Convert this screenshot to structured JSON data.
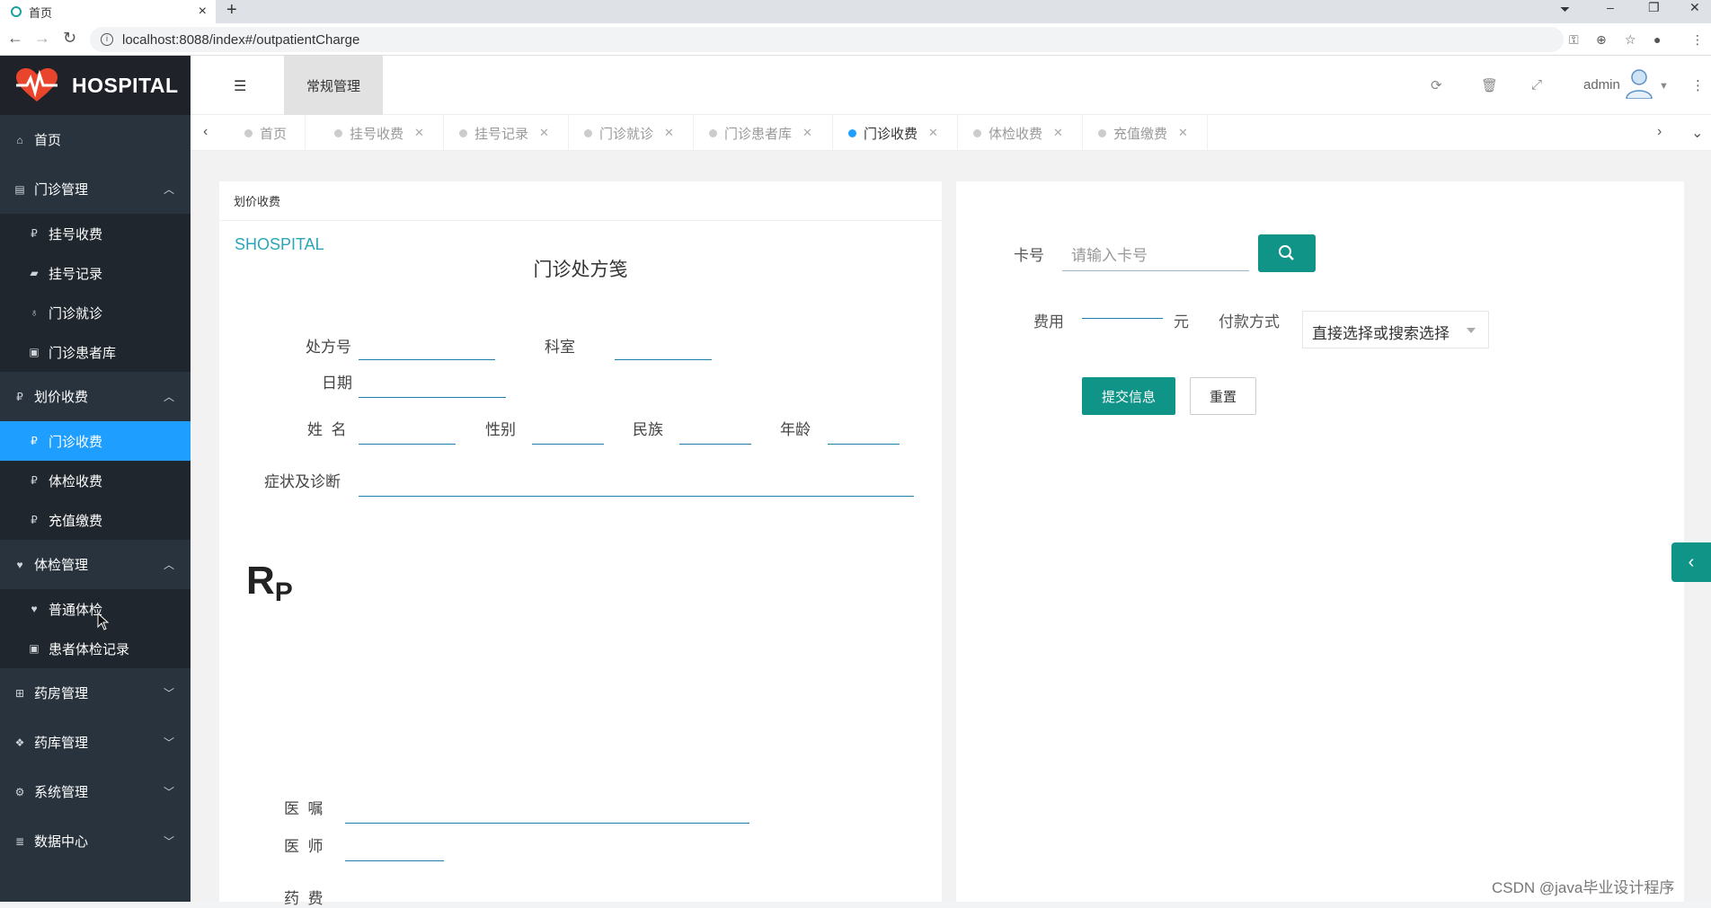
{
  "browser": {
    "tab_title": "首页",
    "tab_close": "×",
    "new_tab": "+",
    "url": "localhost:8088/index#/outpatientCharge",
    "win_min": "–",
    "win_restore": "❐",
    "win_close": "✕"
  },
  "sidebar": {
    "brand": "HOSPITAL",
    "items": [
      {
        "label": "首页",
        "icon": "home-icon"
      },
      {
        "label": "门诊管理",
        "icon": "clipboard-icon",
        "expanded": true,
        "children": [
          "挂号收费",
          "挂号记录",
          "门诊就诊",
          "门诊患者库"
        ]
      },
      {
        "label": "划价收费",
        "icon": "money-icon",
        "expanded": true,
        "children": [
          "门诊收费",
          "体检收费",
          "充值缴费"
        ],
        "active_child": "门诊收费"
      },
      {
        "label": "体检管理",
        "icon": "heartbeat-icon",
        "expanded": true,
        "children": [
          "普通体检",
          "患者体检记录"
        ]
      },
      {
        "label": "药房管理",
        "icon": "plus-square-icon"
      },
      {
        "label": "药库管理",
        "icon": "cubes-icon"
      },
      {
        "label": "系统管理",
        "icon": "gear-icon"
      },
      {
        "label": "数据中心",
        "icon": "database-icon"
      }
    ]
  },
  "header": {
    "top_nav": "常规管理",
    "user": "admin"
  },
  "page_tabs": [
    {
      "label": "首页",
      "closable": false,
      "active": false
    },
    {
      "label": "挂号收费",
      "closable": true,
      "active": false
    },
    {
      "label": "挂号记录",
      "closable": true,
      "active": false
    },
    {
      "label": "门诊就诊",
      "closable": true,
      "active": false
    },
    {
      "label": "门诊患者库",
      "closable": true,
      "active": false
    },
    {
      "label": "门诊收费",
      "closable": true,
      "active": true
    },
    {
      "label": "体检收费",
      "closable": true,
      "active": false
    },
    {
      "label": "充值缴费",
      "closable": true,
      "active": false
    }
  ],
  "prescription": {
    "card_header": "划价收费",
    "brand": "SHOSPITAL",
    "title": "门诊处方笺",
    "labels": {
      "rx_no": "处方号",
      "dept": "科室",
      "date": "日期",
      "name": "姓  名",
      "gender": "性别",
      "ethnicity": "民族",
      "age": "年龄",
      "diagnosis": "症状及诊断",
      "advice": "医  嘱",
      "doctor": "医  师",
      "drug_fee": "药  费"
    },
    "rp_r": "R",
    "rp_p": "P"
  },
  "charge": {
    "card_label": "卡号",
    "card_placeholder": "请输入卡号",
    "fee_label": "费用",
    "fee_unit": "元",
    "pay_label": "付款方式",
    "pay_placeholder": "直接选择或搜索选择",
    "submit": "提交信息",
    "reset": "重置"
  },
  "watermark": "CSDN @java毕业设计程序",
  "colors": {
    "sidebar": "#28333e",
    "active_menu": "#1e9fff",
    "teal_button": "#109488",
    "brand_text": "#2aa6b8"
  }
}
